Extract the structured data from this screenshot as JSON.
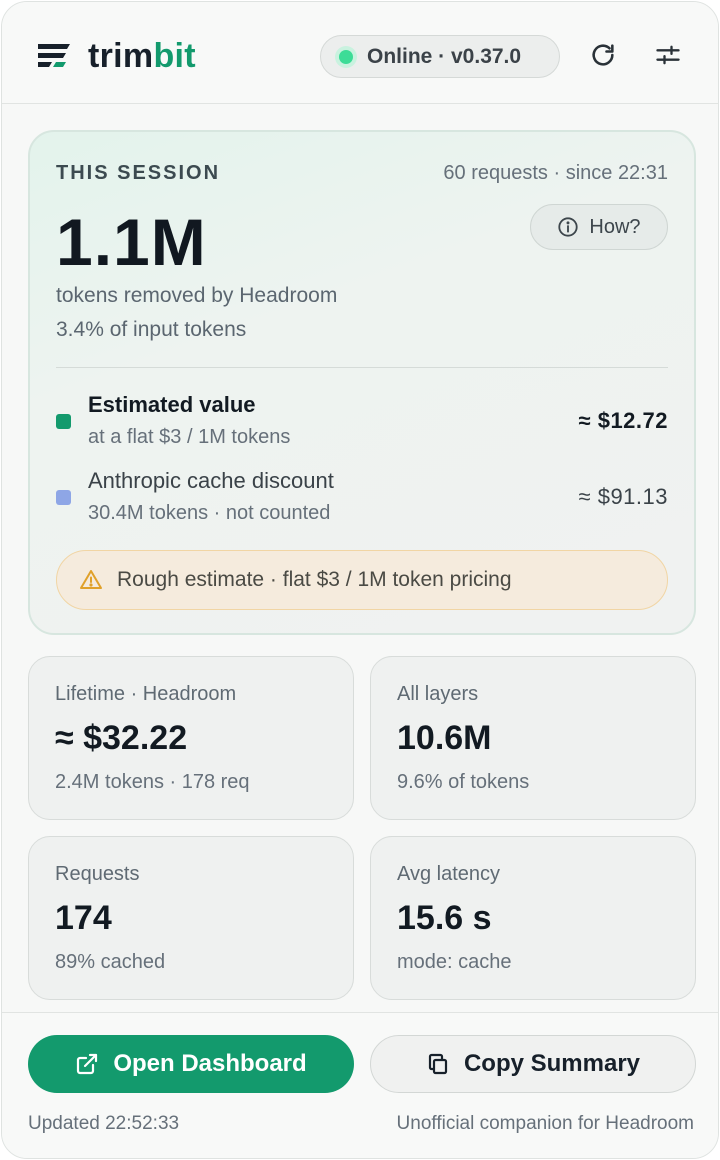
{
  "header": {
    "brand_part1": "trim",
    "brand_part2": "bit",
    "status": "Online · v0.37.0",
    "status_color": "#3ddc97",
    "refresh_icon": "refresh-icon",
    "settings_icon": "sliders-icon"
  },
  "session": {
    "label": "THIS SESSION",
    "meta": "60 requests · since 22:31",
    "tokens_removed": "1.1M",
    "how_label": "How?",
    "sub1": "tokens removed by Headroom",
    "sub2": "3.4% of input tokens",
    "rows": [
      {
        "title": "Estimated value",
        "desc": "at a flat $3 / 1M tokens",
        "value": "≈ $12.72",
        "color": "#139a6d"
      },
      {
        "title": "Anthropic cache discount",
        "desc": "30.4M tokens · not counted",
        "value": "≈ $91.13",
        "color": "#8ea6e6"
      }
    ],
    "warning": "Rough estimate · flat $3 / 1M token pricing"
  },
  "stats": [
    {
      "label": "Lifetime · Headroom",
      "value": "≈ $32.22",
      "sub": "2.4M tokens · 178 req"
    },
    {
      "label": "All layers",
      "value": "10.6M",
      "sub": "9.6% of tokens"
    },
    {
      "label": "Requests",
      "value": "174",
      "sub": "89% cached"
    },
    {
      "label": "Avg latency",
      "value": "15.6 s",
      "sub": "mode: cache"
    }
  ],
  "footer": {
    "open_dashboard": "Open Dashboard",
    "copy_summary": "Copy Summary",
    "updated": "Updated 22:52:33",
    "companion": "Unofficial companion for Headroom"
  },
  "colors": {
    "accent": "#139a6d",
    "warning_border": "#f1d5a4"
  }
}
